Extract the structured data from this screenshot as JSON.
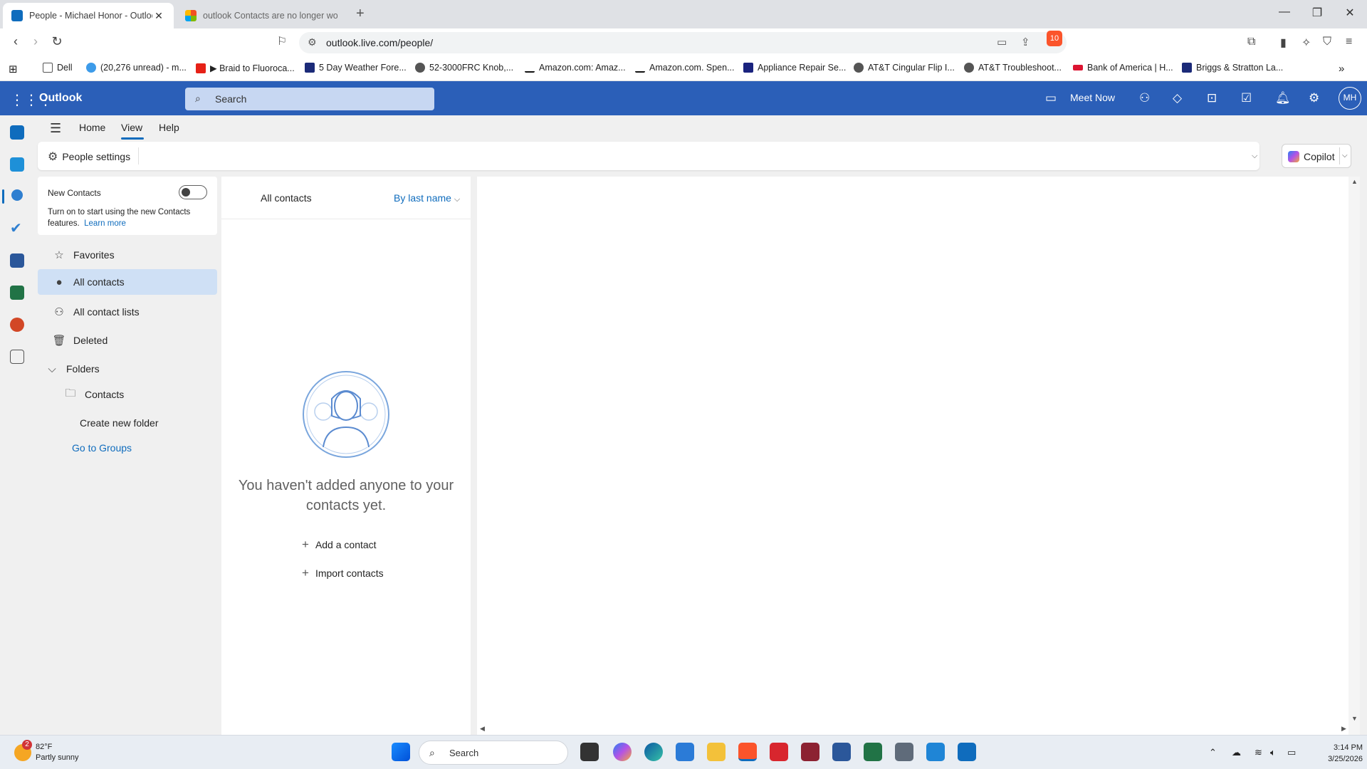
{
  "browser": {
    "tabs": [
      {
        "title": "People - Michael Honor - Outlook",
        "active": true
      },
      {
        "title": "outlook Contacts are no longer working",
        "active": false
      }
    ],
    "url": "outlook.live.com/people/",
    "brave_badge": "10",
    "bookmarks": [
      {
        "label": "Dell",
        "color": "#ffffff"
      },
      {
        "label": "(20,276 unread) - m...",
        "color": "#3d9be9"
      },
      {
        "label": "▶ Braid to Fluoroca...",
        "color": "#e62117"
      },
      {
        "label": "5 Day Weather Fore...",
        "color": "#1b2a78"
      },
      {
        "label": "52-3000FRC Knob,...",
        "color": "#555555"
      },
      {
        "label": "Amazon.com: Amaz...",
        "color": "#111111"
      },
      {
        "label": "Amazon.com. Spen...",
        "color": "#111111"
      },
      {
        "label": "Appliance Repair Se...",
        "color": "#1a237e"
      },
      {
        "label": "AT&T Cingular Flip I...",
        "color": "#555555"
      },
      {
        "label": "AT&T Troubleshoot...",
        "color": "#555555"
      },
      {
        "label": "Bank of America | H...",
        "color": "#dc1431"
      },
      {
        "label": "Briggs & Stratton La...",
        "color": "#1b2a78"
      }
    ]
  },
  "outlook": {
    "brand": "Outlook",
    "search_placeholder": "Search",
    "meet_now": "Meet Now",
    "avatar_initials": "MH",
    "accent": "#2b5fb8"
  },
  "ribbon": {
    "tabs": [
      "Home",
      "View",
      "Help"
    ],
    "selected_tab": "View",
    "people_settings": "People settings",
    "copilot": "Copilot"
  },
  "left_pane": {
    "promo_title": "New Contacts",
    "promo_text": "Turn on to start using the new Contacts features.",
    "promo_link": "Learn more",
    "items": [
      {
        "label": "Favorites",
        "icon": "star-icon"
      },
      {
        "label": "All contacts",
        "icon": "person-icon",
        "selected": true
      },
      {
        "label": "All contact lists",
        "icon": "people-icon"
      },
      {
        "label": "Deleted",
        "icon": "trash-icon"
      },
      {
        "label": "Folders",
        "icon": "chevron-down-icon"
      },
      {
        "label": "Contacts",
        "icon": "folder-people-icon"
      }
    ],
    "create_folder": "Create new folder",
    "go_to_groups": "Go to Groups"
  },
  "list_pane": {
    "title": "All contacts",
    "sort": "By last name",
    "empty_message": "You haven't added anyone to your contacts yet.",
    "add_contact": "Add a contact",
    "import_contacts": "Import contacts"
  },
  "taskbar": {
    "weather_temp": "82°F",
    "weather_desc": "Partly sunny",
    "weather_badge": "2",
    "search_placeholder": "Search",
    "time": "3:14 PM",
    "date": "3/25/2026"
  }
}
